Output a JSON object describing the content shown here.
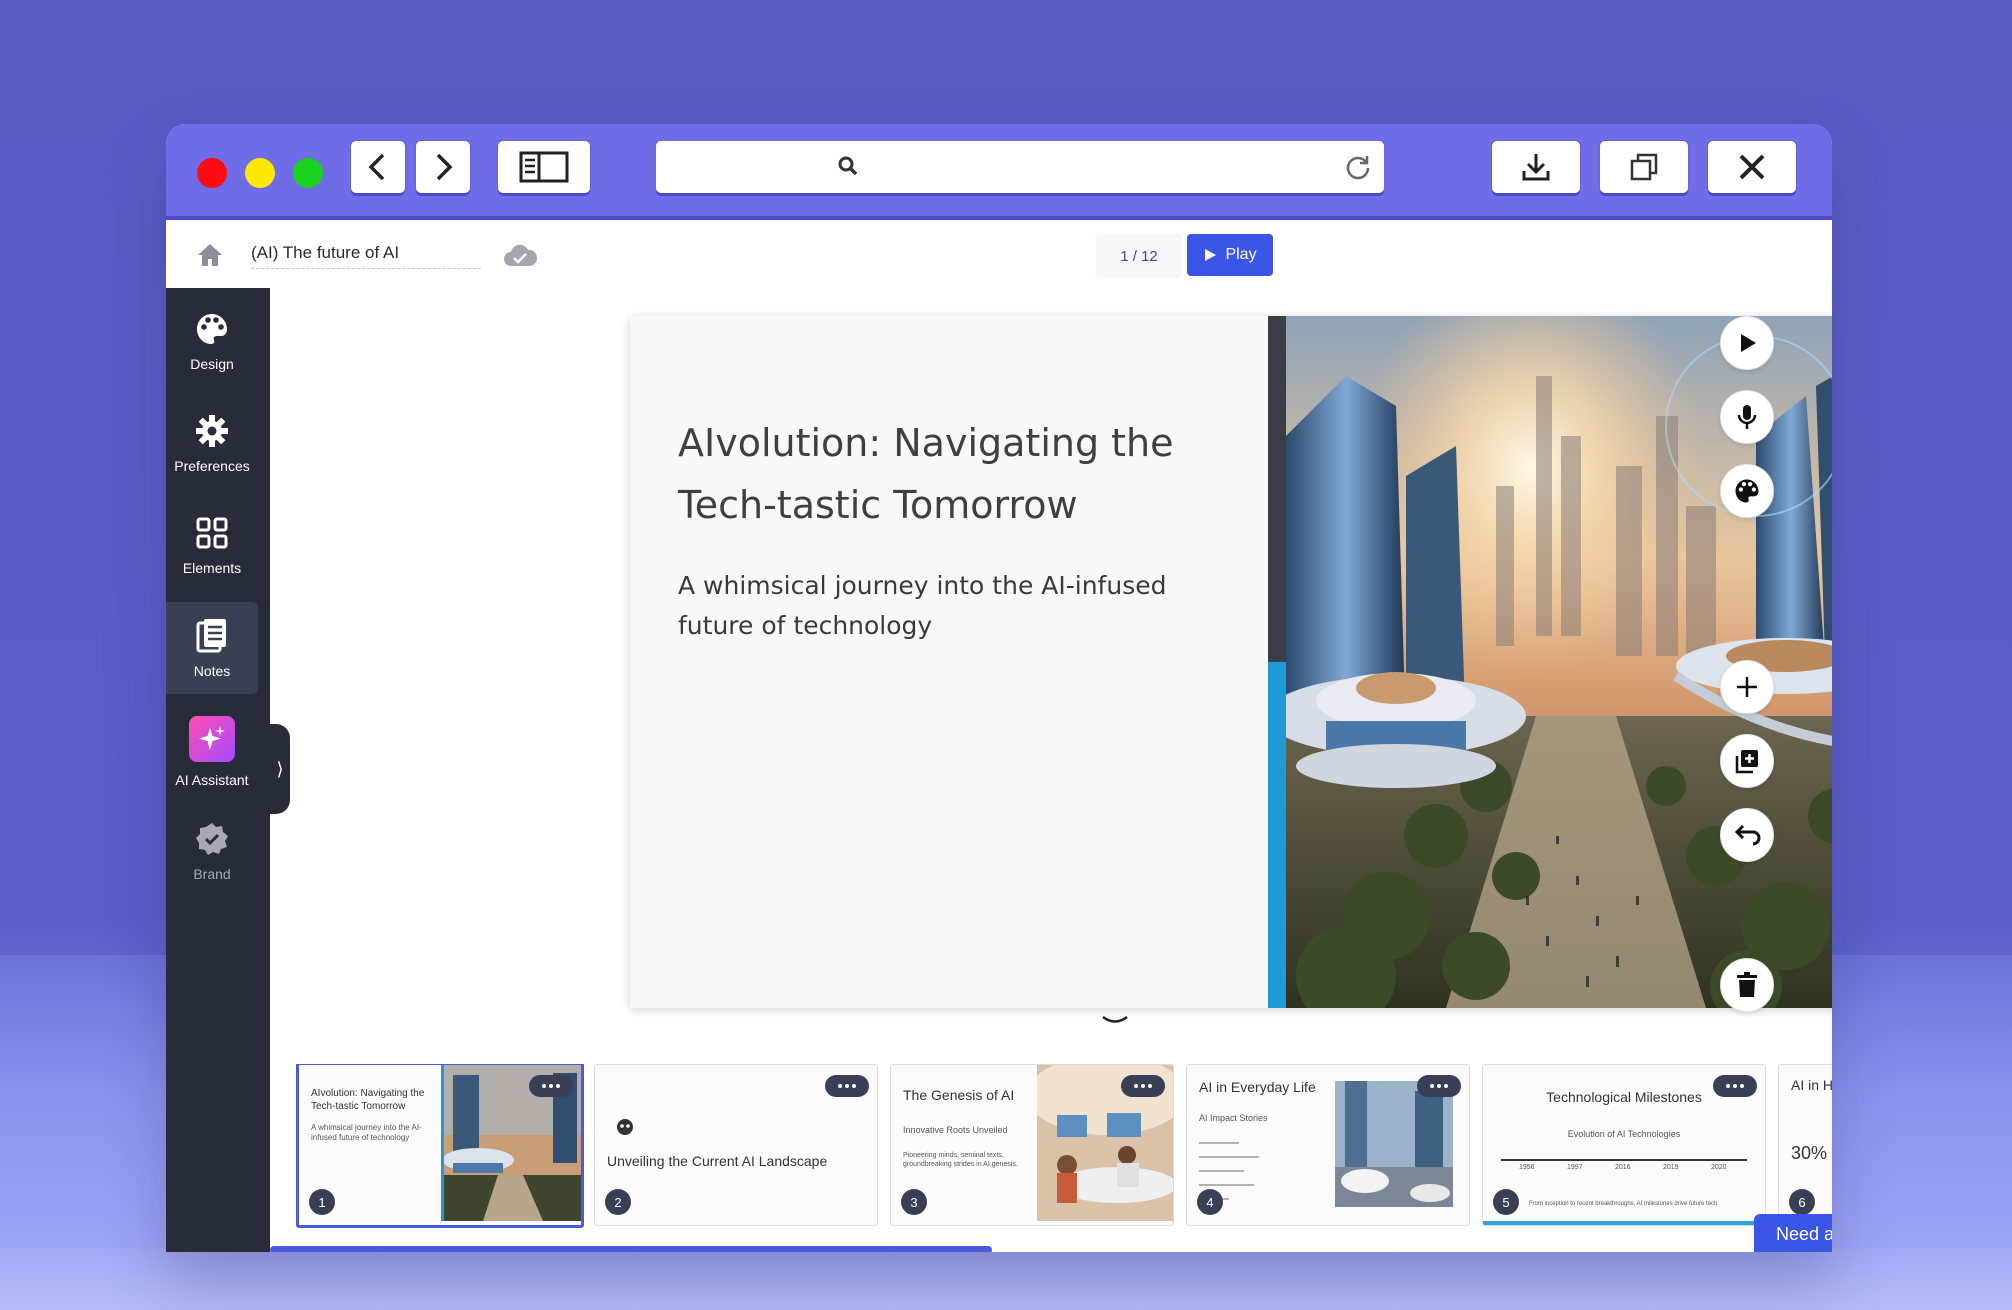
{
  "app": {
    "doc_title": "(AI) The future of AI",
    "page_indicator": "1 / 12",
    "play_label": "Play",
    "help_label": "Need a"
  },
  "sidebar": {
    "items": [
      {
        "label": "Design",
        "icon": "palette-icon"
      },
      {
        "label": "Preferences",
        "icon": "gear-icon"
      },
      {
        "label": "Elements",
        "icon": "grid-icon"
      },
      {
        "label": "Notes",
        "icon": "notes-icon"
      },
      {
        "label": "AI Assistant",
        "icon": "sparkle-icon"
      },
      {
        "label": "Brand",
        "icon": "badge-check-icon"
      }
    ]
  },
  "slide": {
    "title": "AIvolution: Navigating the Tech-tastic Tomorrow",
    "subtitle": "A whimsical journey into the AI-infused future of technology"
  },
  "thumbnails": [
    {
      "num": "1",
      "title": "AIvolution: Navigating the Tech-tastic Tomorrow",
      "sub": "A whimsical journey into the AI-infused future of technology"
    },
    {
      "num": "2",
      "title": "Unveiling the Current AI Landscape"
    },
    {
      "num": "3",
      "title": "The Genesis of AI",
      "sub": "Innovative Roots Unveiled",
      "body": "Pioneering minds, seminal texts, groundbreaking strides in AI genesis."
    },
    {
      "num": "4",
      "title": "AI in Everyday Life",
      "sub": "AI Impact Stories"
    },
    {
      "num": "5",
      "title": "Technological Milestones",
      "sub": "Evolution of AI Technologies",
      "years": [
        "1956",
        "1997",
        "2016",
        "2019",
        "2020"
      ],
      "caption": "From inception to recent breakthroughs, AI milestones drive future tech."
    },
    {
      "num": "6",
      "title": "AI in He",
      "stat": "30%"
    }
  ],
  "colors": {
    "accent": "#3b55e6",
    "titlebar": "#6e6ce6",
    "sidebar": "#272b3a",
    "slide_accent_blue": "#1f9ad8"
  }
}
